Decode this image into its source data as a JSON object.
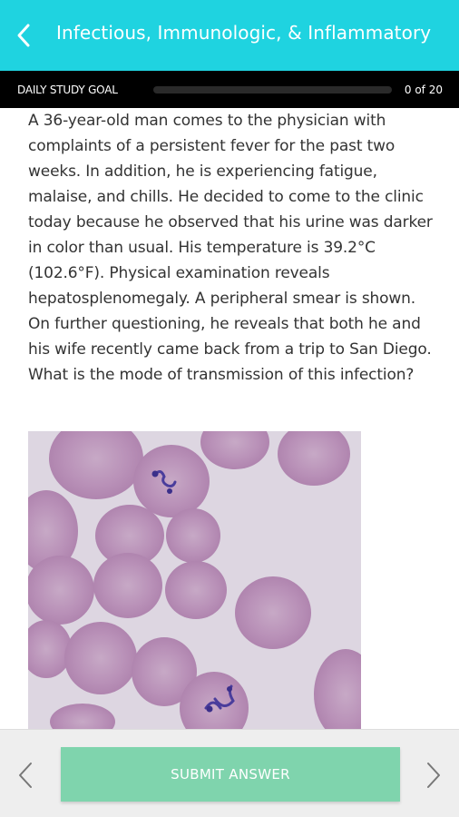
{
  "header": {
    "title": "Infectious, Immunologic, & Inflammatory",
    "back_icon": "chevron-left-icon",
    "background_color": "#1fd3e0"
  },
  "study_goal": {
    "label": "DAILY STUDY GOAL",
    "progress_fraction": 0,
    "count_text": "0 of 20"
  },
  "question": {
    "text": "A 36-year-old man comes to the physician with complaints of a persistent fever for the past two weeks. In addition, he is experiencing fatigue, malaise, and chills. He decided to come to the clinic today because he observed that his urine was darker in color than usual. His temperature is 39.2°C (102.6°F). Physical examination reveals hepatosplenomegaly. A peripheral smear is shown. On further questioning, he reveals that both he and his wife recently came back from a trip to San Diego. What is the mode of transmission of this infection?"
  },
  "footer": {
    "submit_label": "SUBMIT ANSWER",
    "submit_color": "#7fd4ad",
    "prev_icon": "chevron-left-icon",
    "next_icon": "chevron-right-icon"
  }
}
